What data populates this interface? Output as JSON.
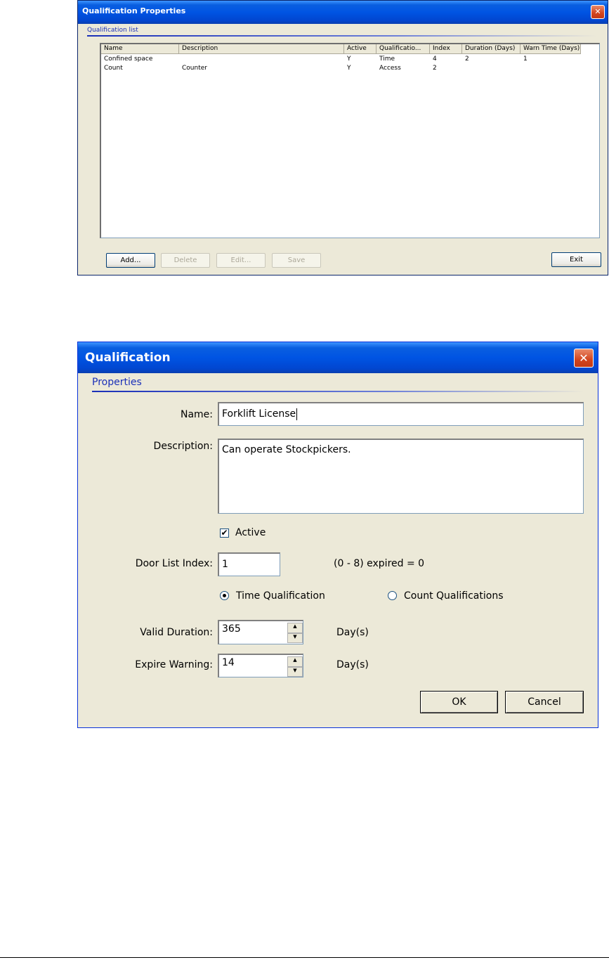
{
  "dialog1": {
    "title": "Qualification Properties",
    "close_glyph": "✕",
    "group_label": "Qualification list",
    "columns": [
      "Name",
      "Description",
      "Active",
      "Qualificatio...",
      "Index",
      "Duration (Days)",
      "Warn Time (Days)"
    ],
    "rows": [
      [
        "Confined space",
        "",
        "Y",
        "Time",
        "4",
        "2",
        "1"
      ],
      [
        "Count",
        "Counter",
        "Y",
        "Access",
        "2",
        "",
        ""
      ]
    ],
    "buttons": {
      "add": "Add...",
      "delete": "Delete",
      "edit": "Edit...",
      "save": "Save",
      "exit": "Exit"
    }
  },
  "dialog2": {
    "title": "Qualification",
    "close_glyph": "✕",
    "group_label": "Properties",
    "name_label": "Name:",
    "name_value": "Forklift License",
    "description_label": "Description:",
    "description_value": "Can operate Stockpickers.",
    "active_label": "Active",
    "active_checked": true,
    "door_list_label": "Door List Index:",
    "door_list_value": "1",
    "door_list_hint": "(0 - 8) expired = 0",
    "time_qual_label": "Time Qualification",
    "count_qual_label": "Count Qualifications",
    "selected_qualification": "time",
    "valid_duration_label": "Valid Duration:",
    "valid_duration_value": "365",
    "expire_warning_label": "Expire Warning:",
    "expire_warning_value": "14",
    "days_unit": "Day(s)",
    "ok_label": "OK",
    "cancel_label": "Cancel"
  }
}
